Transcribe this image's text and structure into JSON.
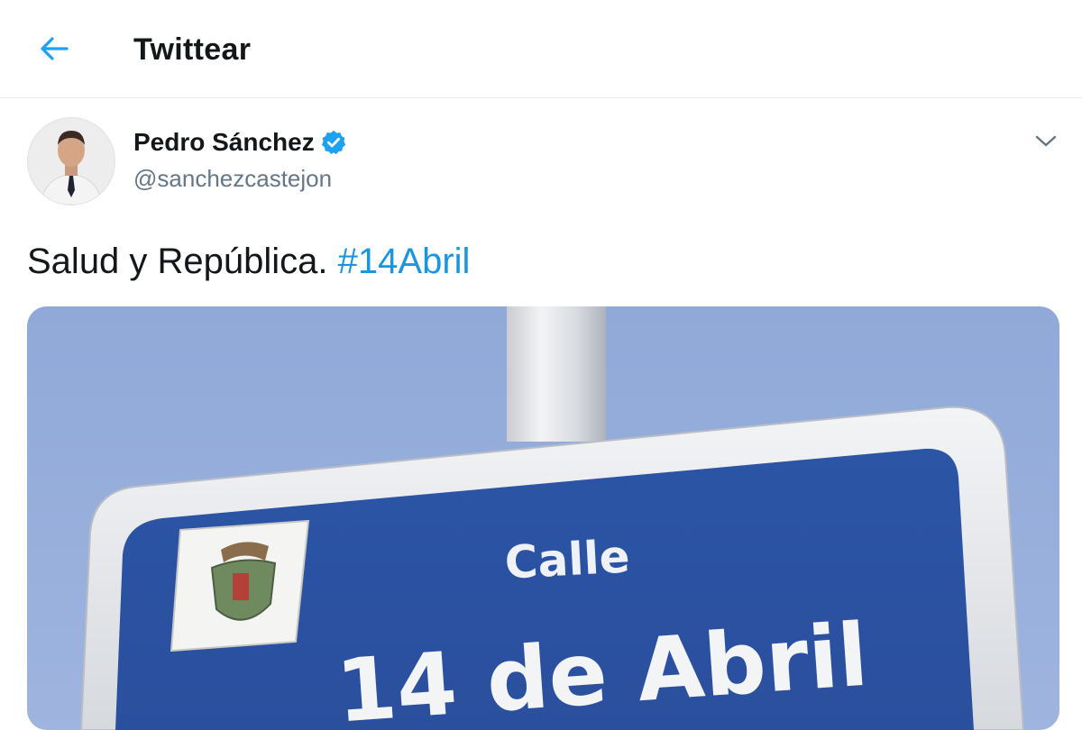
{
  "header": {
    "back_icon": "arrow-left-icon",
    "title": "Twittear"
  },
  "tweet": {
    "author": {
      "name": "Pedro Sánchez",
      "verified": true,
      "handle": "@sanchezcastejon"
    },
    "menu_icon": "chevron-down-icon",
    "text_prefix": "Salud y República. ",
    "hashtag": "#14Abril",
    "media": {
      "sign_line1": "Calle",
      "sign_line2": "14 de Abril"
    }
  },
  "colors": {
    "accent": "#1b95e0",
    "text": "#14171a",
    "secondary_text": "#657786",
    "sign_blue": "#2f57a8",
    "sky": "#99b0dc"
  }
}
